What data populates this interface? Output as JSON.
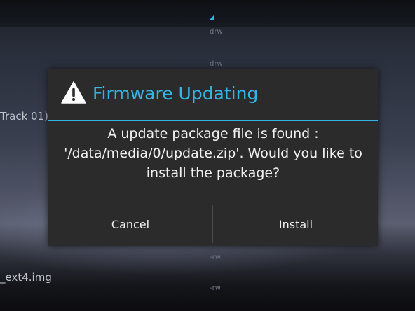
{
  "background": {
    "permissions": [
      "drw",
      "drw",
      "-rw",
      "-rw"
    ],
    "file_labels": [
      "Track 01)",
      "_ext4.img"
    ]
  },
  "dialog": {
    "icon": "warning-icon",
    "title": "Firmware Updating",
    "message": "A update package file is found : '/data/media/0/update.zip'. Would you like to install the package?",
    "buttons": {
      "cancel": "Cancel",
      "install": "Install"
    }
  },
  "colors": {
    "accent": "#33b5e5",
    "dialog_bg": "#2b2b2b",
    "text": "#f2f2f2"
  }
}
